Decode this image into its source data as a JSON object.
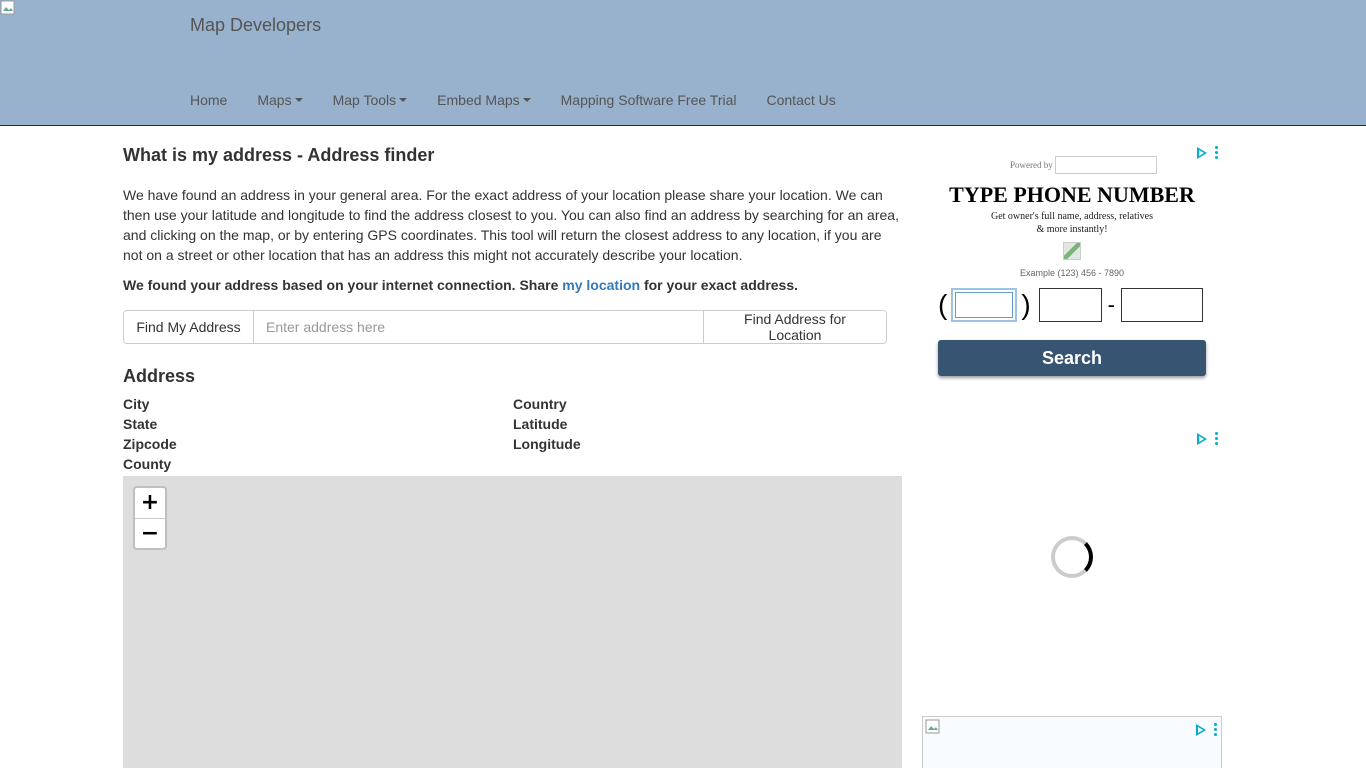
{
  "header": {
    "brand": "Map Developers",
    "nav": [
      {
        "label": "Home",
        "dropdown": false
      },
      {
        "label": "Maps",
        "dropdown": true
      },
      {
        "label": "Map Tools",
        "dropdown": true
      },
      {
        "label": "Embed Maps",
        "dropdown": true
      },
      {
        "label": "Mapping Software Free Trial",
        "dropdown": false
      },
      {
        "label": "Contact Us",
        "dropdown": false
      }
    ]
  },
  "main": {
    "title": "What is my address - Address finder",
    "intro": "We have found an address in your general area. For the exact address of your location please share your location. We can then use your latitude and longitude to find the address closest to you. You can also find an address by searching for an area, and clicking on the map, or by entering GPS coordinates. This tool will return the closest address to any location, if you are not on a street or other location that has an address this might not accurately describe your location.",
    "notice_prefix": "We found your address based on your internet connection. Share ",
    "notice_link": "my location",
    "notice_suffix": " for your exact address.",
    "find_my_address": "Find My Address",
    "address_placeholder": "Enter address here",
    "find_for_location": "Find Address for Location",
    "address_heading": "Address",
    "fields": {
      "city": "City",
      "country": "Country",
      "state": "State",
      "latitude": "Latitude",
      "zipcode": "Zipcode",
      "longitude": "Longitude",
      "county": "County"
    },
    "zoom_in": "+",
    "zoom_out": "−"
  },
  "ad": {
    "powered": "Powered by",
    "headline": "TYPE PHONE NUMBER",
    "sub1": "Get owner's full name, address, relatives",
    "sub2": "& more instantly!",
    "example": "Example (123) 456 - 7890",
    "open_paren": "(",
    "close_paren": ")",
    "dash": "-",
    "search": "Search"
  },
  "colors": {
    "header_bg": "#98b1cd",
    "link": "#337ab7",
    "ad_button": "#375573",
    "ad_choices": "#00aecd",
    "map_bg": "#dddddd"
  }
}
